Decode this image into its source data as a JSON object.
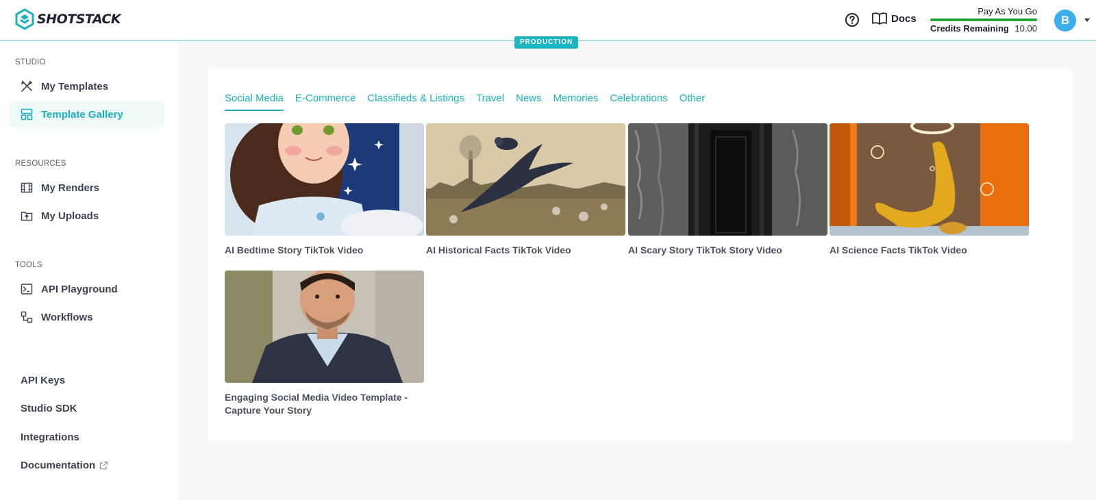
{
  "header": {
    "logo_text": "SHOTSTACK",
    "environment_badge": "PRODUCTION",
    "docs_label": "Docs",
    "plan_name": "Pay As You Go",
    "credits_label": "Credits Remaining",
    "credits_value": "10.00",
    "avatar_initial": "B",
    "colors": {
      "accent": "#1ab0bd",
      "plan_bar": "#22a43a",
      "avatar": "#3daee9"
    }
  },
  "sidebar": {
    "studio_title": "STUDIO",
    "studio_items": [
      {
        "label": "My Templates",
        "icon": "tools-icon"
      },
      {
        "label": "Template Gallery",
        "icon": "gallery-layout-icon",
        "active": true
      }
    ],
    "resources_title": "RESOURCES",
    "resources_items": [
      {
        "label": "My Renders",
        "icon": "film-strip-icon"
      },
      {
        "label": "My Uploads",
        "icon": "upload-folder-icon"
      }
    ],
    "tools_title": "TOOLS",
    "tools_items": [
      {
        "label": "API Playground",
        "icon": "terminal-icon"
      },
      {
        "label": "Workflows",
        "icon": "workflow-icon"
      }
    ],
    "links": [
      {
        "label": "API Keys"
      },
      {
        "label": "Studio SDK"
      },
      {
        "label": "Integrations"
      },
      {
        "label": "Documentation",
        "icon": "external-link-icon"
      }
    ]
  },
  "gallery": {
    "tabs": [
      "Social Media",
      "E-Commerce",
      "Classifieds & Listings",
      "Travel",
      "News",
      "Memories",
      "Celebrations",
      "Other"
    ],
    "active_tab": "Social Media",
    "templates": [
      {
        "title": "AI Bedtime Story TikTok Video"
      },
      {
        "title": "AI Historical Facts TikTok Video"
      },
      {
        "title": "AI Scary Story TikTok Story Video"
      },
      {
        "title": "AI Science Facts TikTok Video"
      },
      {
        "title": "Engaging Social Media Video Template - Capture Your Story"
      }
    ]
  }
}
